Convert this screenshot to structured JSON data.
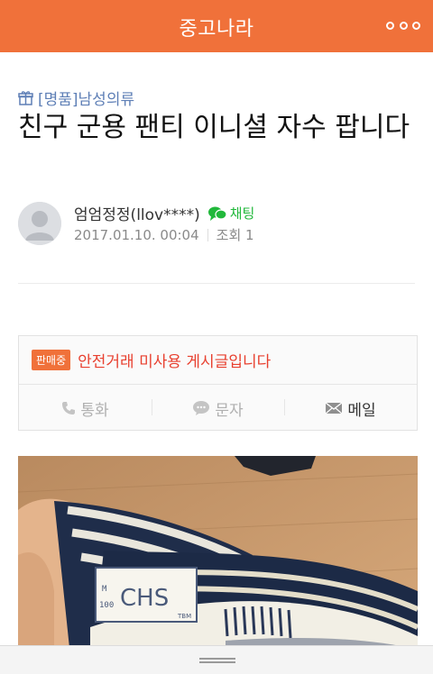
{
  "app": {
    "title": "중고나라"
  },
  "post": {
    "category": "[명품]남성의류",
    "title": "친구 군용 팬티 이니셜 자수 팝니다"
  },
  "author": {
    "name": "엄엄정정(llov****)",
    "chat_label": "채팅",
    "date": "2017.01.10. 00:04",
    "views": "조회 1"
  },
  "trade": {
    "badge": "판매중",
    "notice": "안전거래 미사용 게시글입니다",
    "call_label": "통화",
    "sms_label": "문자",
    "mail_label": "메일"
  },
  "photo": {
    "label_text": "CHS",
    "tag_letters": "M 100",
    "tag_brand": "TBM"
  },
  "colors": {
    "brand": "#f0713a",
    "category": "#5e7fb6",
    "chat": "#21b83b",
    "notice": "#e8402f"
  }
}
